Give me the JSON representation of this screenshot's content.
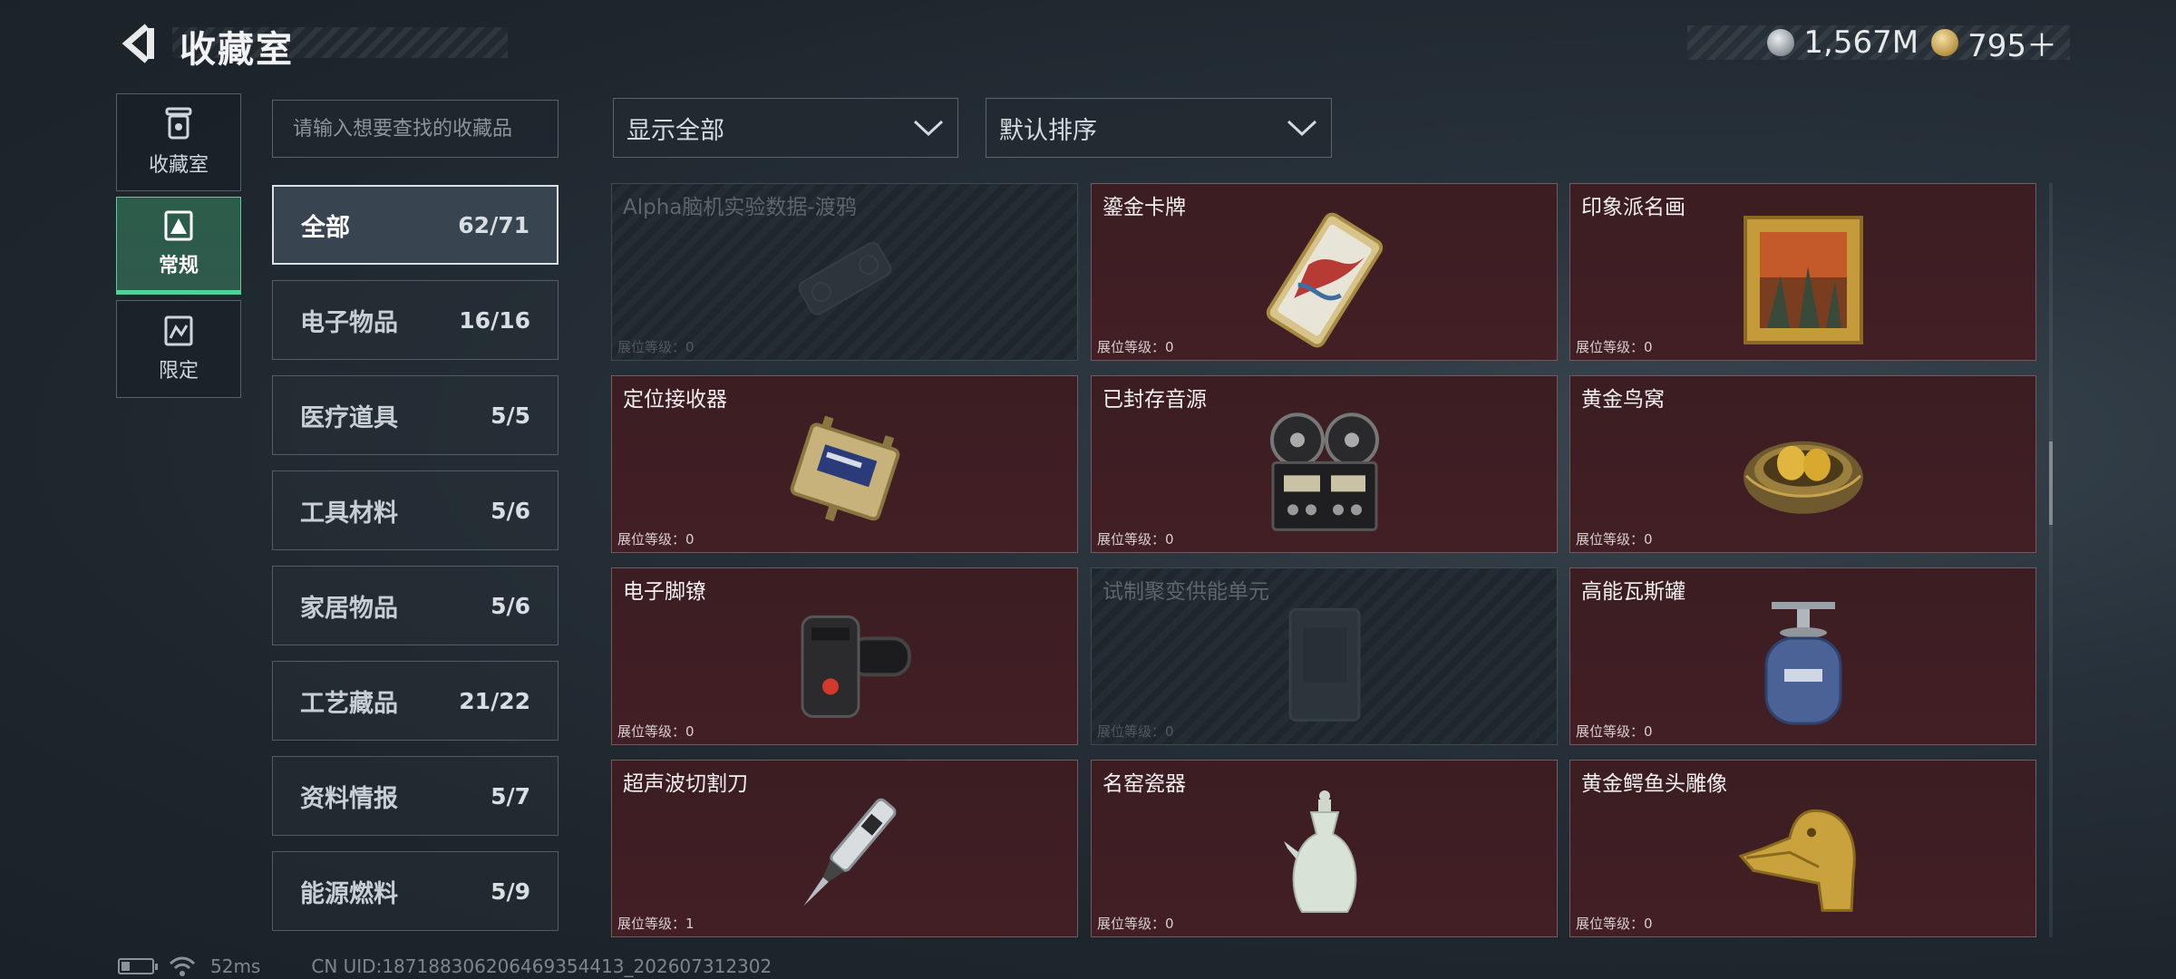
{
  "header": {
    "title": "收藏室",
    "currency": [
      {
        "icon": "silver-coin-icon",
        "value": "1,567M"
      },
      {
        "icon": "gold-coin-icon",
        "value": "795＋"
      }
    ]
  },
  "category_tabs": [
    {
      "label": "收藏室",
      "icon": "collection-room-icon",
      "active": false
    },
    {
      "label": "常规",
      "icon": "regular-icon",
      "active": true
    },
    {
      "label": "限定",
      "icon": "limited-icon",
      "active": false
    }
  ],
  "search": {
    "placeholder": "请输入想要查找的收藏品"
  },
  "subcategories": [
    {
      "name": "全部",
      "count": "62/71"
    },
    {
      "name": "电子物品",
      "count": "16/16"
    },
    {
      "name": "医疗道具",
      "count": "5/5"
    },
    {
      "name": "工具材料",
      "count": "5/6"
    },
    {
      "name": "家居物品",
      "count": "5/6"
    },
    {
      "name": "工艺藏品",
      "count": "21/22"
    },
    {
      "name": "资料情报",
      "count": "5/7"
    },
    {
      "name": "能源燃料",
      "count": "5/9"
    }
  ],
  "filters": {
    "display": "显示全部",
    "sort": "默认排序"
  },
  "level_label": "展位等级：",
  "items": [
    {
      "name": "Alpha脑机实验数据-渡鸦",
      "level": "0",
      "owned": false,
      "icon": "data-drive-icon"
    },
    {
      "name": "鎏金卡牌",
      "level": "0",
      "owned": true,
      "icon": "gilded-card-icon"
    },
    {
      "name": "印象派名画",
      "level": "0",
      "owned": true,
      "icon": "framed-painting-icon"
    },
    {
      "name": "定位接收器",
      "level": "0",
      "owned": true,
      "icon": "gps-receiver-icon"
    },
    {
      "name": "已封存音源",
      "level": "0",
      "owned": true,
      "icon": "reel-to-reel-recorder-icon"
    },
    {
      "name": "黄金鸟窝",
      "level": "0",
      "owned": true,
      "icon": "golden-nest-icon"
    },
    {
      "name": "电子脚镣",
      "level": "0",
      "owned": true,
      "icon": "ankle-monitor-icon"
    },
    {
      "name": "试制聚变供能单元",
      "level": "0",
      "owned": false,
      "icon": "fusion-cell-icon"
    },
    {
      "name": "高能瓦斯罐",
      "level": "0",
      "owned": true,
      "icon": "gas-canister-icon"
    },
    {
      "name": "超声波切割刀",
      "level": "1",
      "owned": true,
      "icon": "ultrasonic-cutter-icon"
    },
    {
      "name": "名窑瓷器",
      "level": "0",
      "owned": true,
      "icon": "porcelain-vase-icon"
    },
    {
      "name": "黄金鳄鱼头雕像",
      "level": "0",
      "owned": true,
      "icon": "gold-crocodile-head-icon"
    }
  ],
  "status": {
    "ping": "52ms",
    "uid": "CN UID:1871883062064693544​13_202607312302"
  },
  "colors": {
    "owned_card": "#421f25",
    "active_tab": "#2f5a4c",
    "active_tab_accent": "#4fd19a"
  }
}
